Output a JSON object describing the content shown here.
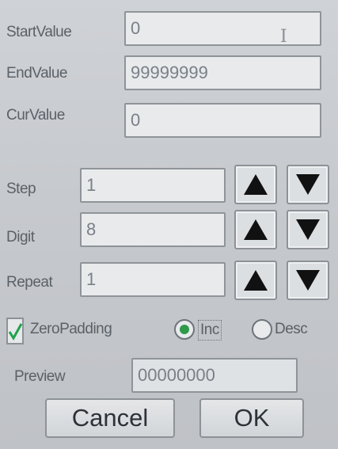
{
  "fields": {
    "start": {
      "label": "StartValue",
      "value": "0"
    },
    "end": {
      "label": "EndValue",
      "value": "99999999"
    },
    "cur": {
      "label": "CurValue",
      "value": "0"
    },
    "step": {
      "label": "Step",
      "value": "1"
    },
    "digit": {
      "label": "Digit",
      "value": "8"
    },
    "repeat": {
      "label": "Repeat",
      "value": "1"
    },
    "preview": {
      "label": "Preview",
      "value": "00000000"
    }
  },
  "options": {
    "zero_padding": {
      "label": "ZeroPadding",
      "checked": true
    },
    "direction": {
      "inc_label": "Inc",
      "desc_label": "Desc",
      "selected": "Inc"
    }
  },
  "buttons": {
    "cancel": "Cancel",
    "ok": "OK"
  },
  "colors": {
    "check_mark": "#21a24a",
    "radio_selected": "#2f9a4a",
    "arrow_fill": "#111111"
  },
  "icons": {
    "up": "triangle-up-icon",
    "down": "triangle-down-icon",
    "text_cursor": "i-beam-cursor-icon",
    "check": "checkmark-icon"
  }
}
